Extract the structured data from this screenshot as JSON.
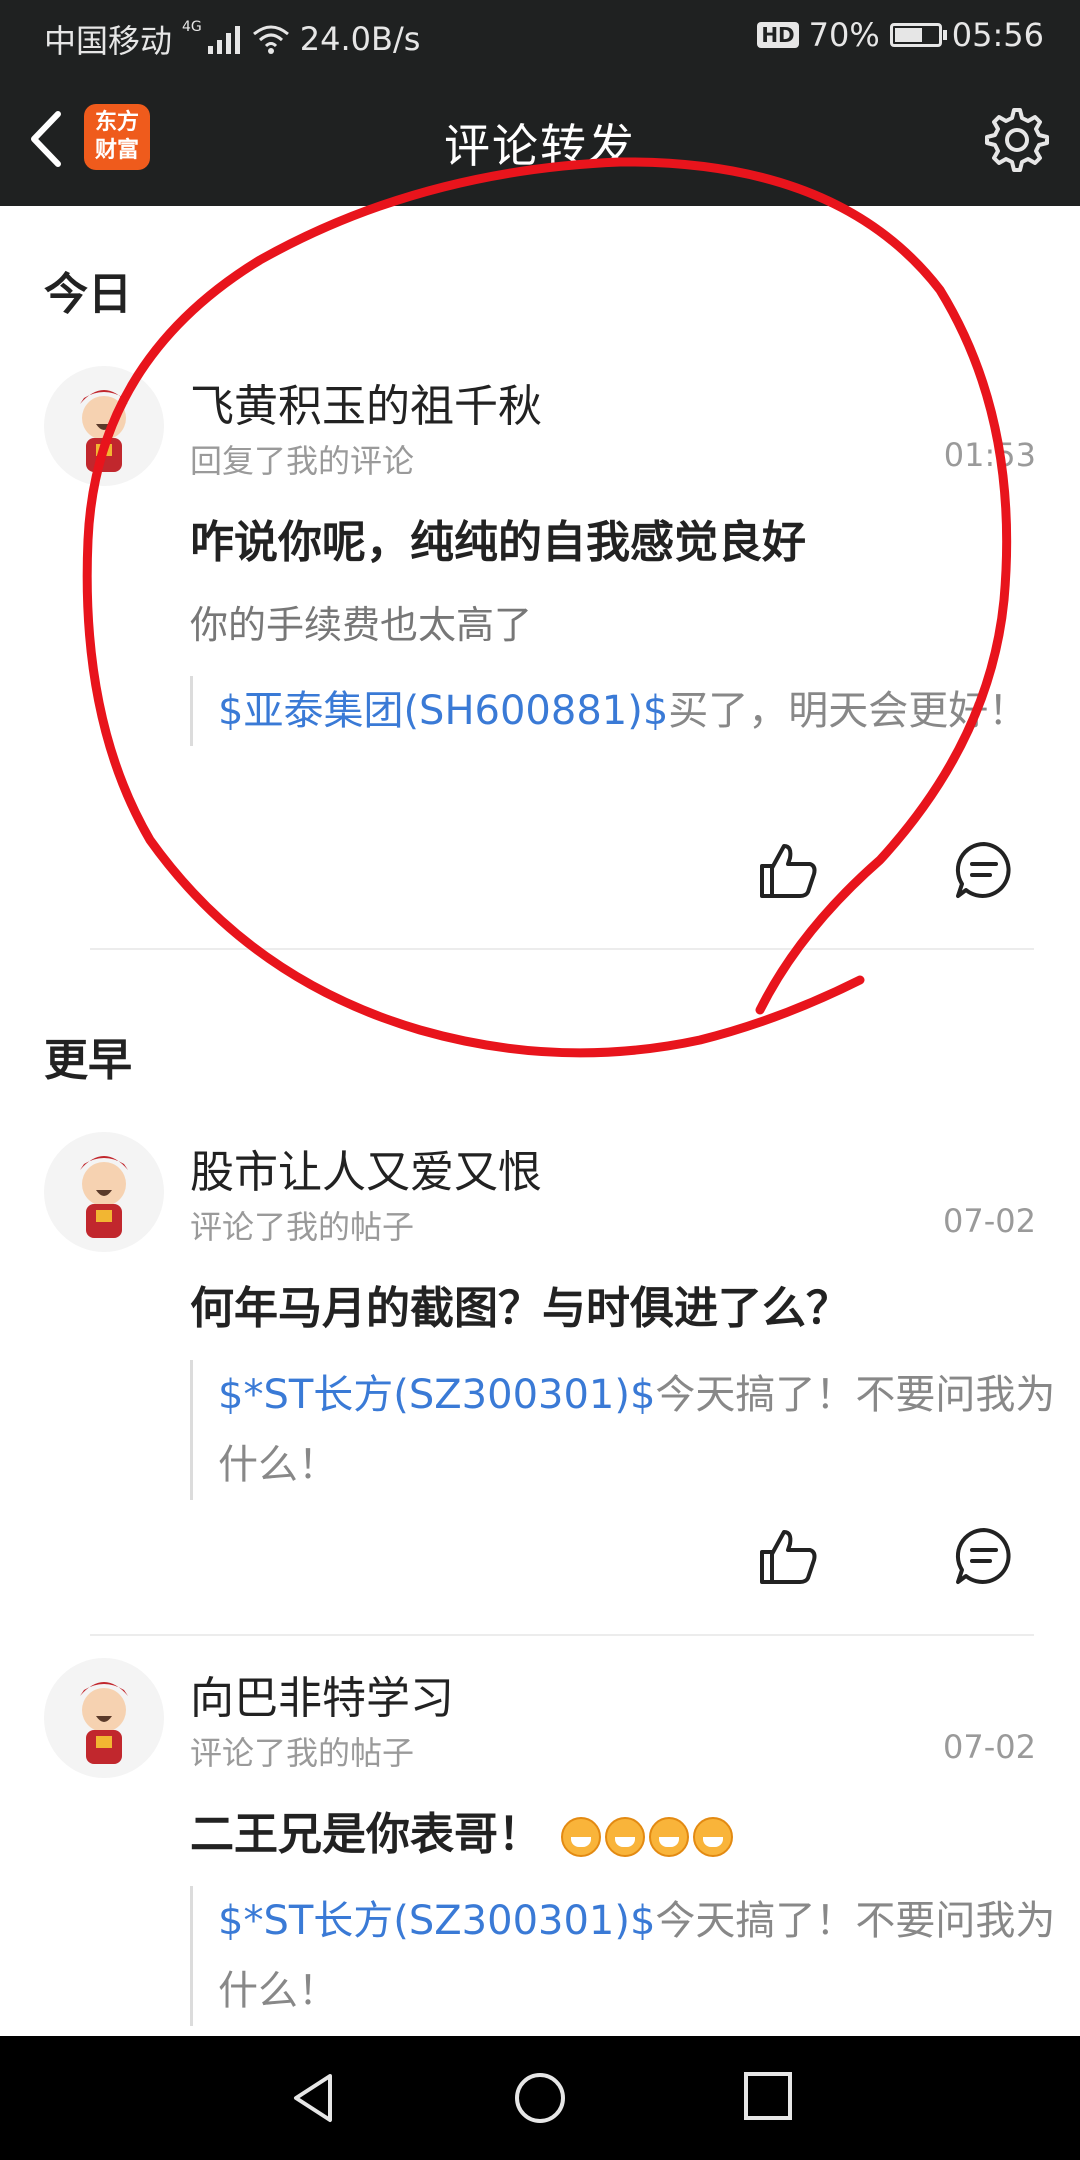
{
  "status_bar": {
    "carrier": "中国移动",
    "network_tag": "4G",
    "speed": "24.0B/s",
    "hd": "HD",
    "battery": "70%",
    "battery_level": 0.7,
    "time": "05:56"
  },
  "nav": {
    "title": "评论转发",
    "logo_line1": "东方",
    "logo_line2": "财富"
  },
  "sections": {
    "today": "今日",
    "earlier": "更早"
  },
  "items": [
    {
      "user": "飞黄积玉的祖千秋",
      "action": "回复了我的评论",
      "time": "01:53",
      "reply": "咋说你呢，纯纯的自我感觉良好",
      "subtext": "你的手续费也太高了",
      "quote_stock": "$亚泰集团(SH600881)$",
      "quote_text": "买了，明天会更好！"
    },
    {
      "user": "股市让人又爱又恨",
      "action": "评论了我的帖子",
      "time": "07-02",
      "reply": "何年马月的截图？与时俱进了么？",
      "quote_stock": "$*ST长方(SZ300301)$",
      "quote_text": "今天搞了！不要问我为什么！"
    },
    {
      "user": "向巴非特学习",
      "action": "评论了我的帖子",
      "time": "07-02",
      "reply": "二王兄是你表哥！",
      "quote_stock": "$*ST长方(SZ300301)$",
      "quote_text": "今天搞了！不要问我为什么！"
    }
  ],
  "colors": {
    "header_bg": "#1f2121",
    "stock_link": "#3a7ad6",
    "brand_orange": "#ef5b1c",
    "annotation_red": "#e8141c"
  },
  "icons": [
    "back-icon",
    "settings-icon",
    "like-icon",
    "comment-icon",
    "avatar",
    "grin-emoji"
  ]
}
